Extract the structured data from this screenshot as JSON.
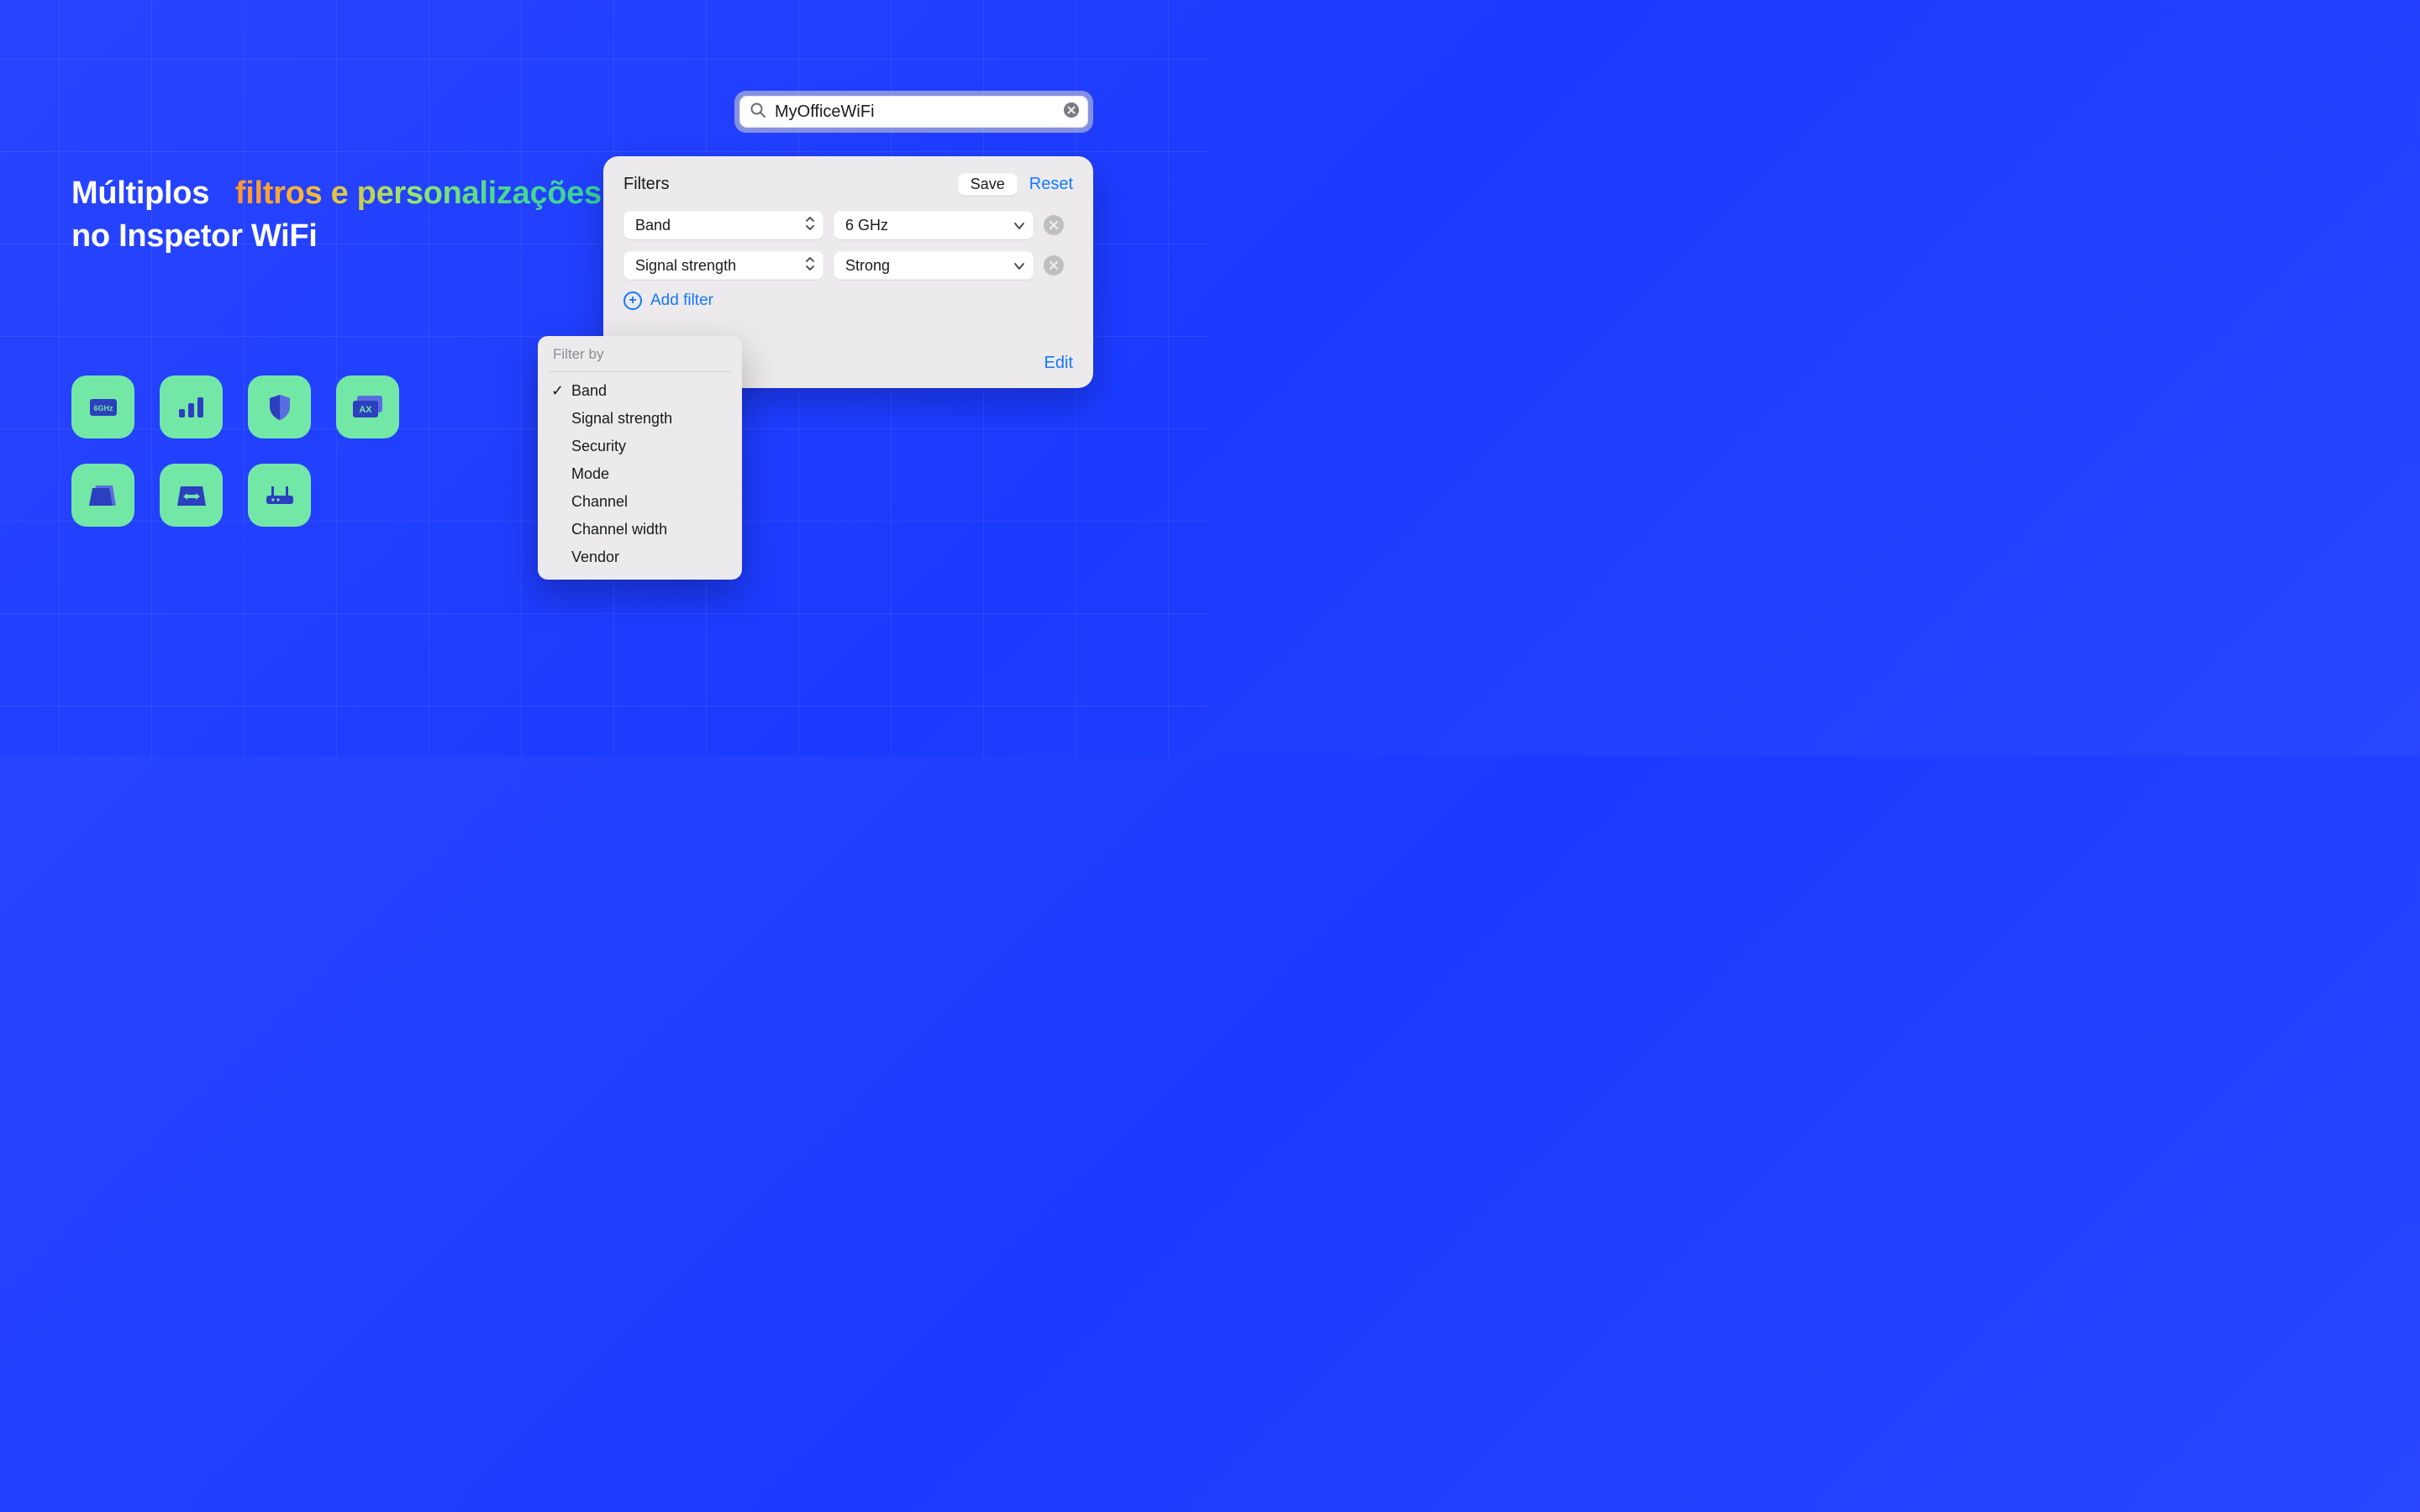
{
  "headline": {
    "part1": "Múltiplos",
    "gradient": "filtros e personalizações",
    "part3": "no Inspetor WiFi"
  },
  "search": {
    "value": "MyOfficeWiFi"
  },
  "panel": {
    "title": "Filters",
    "save": "Save",
    "reset": "Reset",
    "edit": "Edit",
    "add_filter": "Add filter",
    "rows": [
      {
        "key": "Band",
        "value": "6 GHz"
      },
      {
        "key": "Signal strength",
        "value": "Strong"
      }
    ]
  },
  "menu": {
    "header": "Filter by",
    "items": [
      {
        "label": "Band",
        "selected": true
      },
      {
        "label": "Signal strength",
        "selected": false
      },
      {
        "label": "Security",
        "selected": false
      },
      {
        "label": "Mode",
        "selected": false
      },
      {
        "label": "Channel",
        "selected": false
      },
      {
        "label": "Channel width",
        "selected": false
      },
      {
        "label": "Vendor",
        "selected": false
      }
    ]
  },
  "tiles": [
    "band-6ghz-icon",
    "signal-bars-icon",
    "shield-icon",
    "mode-ax-icon",
    "channel-icon",
    "channel-width-icon",
    "router-icon"
  ]
}
